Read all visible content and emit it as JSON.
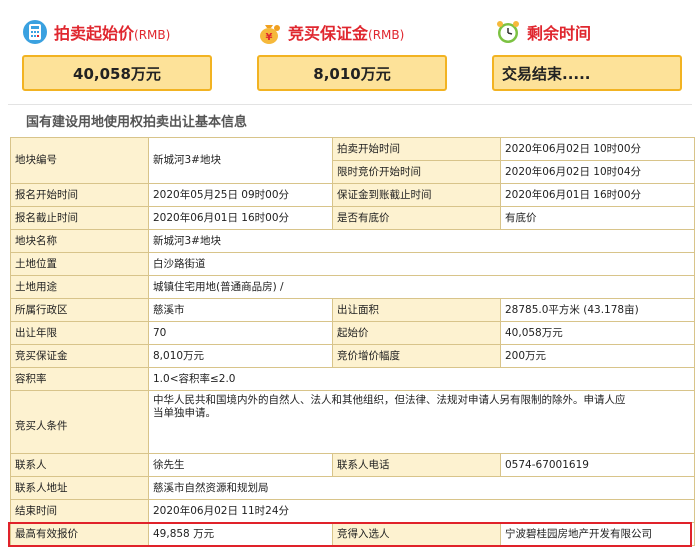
{
  "header": {
    "start_price": {
      "label": "拍卖起始价",
      "unit": "(RMB)",
      "value": "40,058万元",
      "icon": "calculator-icon"
    },
    "deposit": {
      "label": "竞买保证金",
      "unit": "(RMB)",
      "value": "8,010万元",
      "icon": "money-bag-icon"
    },
    "remaining": {
      "label": "剩余时间",
      "value": "交易结束.....",
      "icon": "alarm-clock-icon"
    }
  },
  "section_title": "国有建设用地使用权拍卖出让基本信息",
  "table": {
    "parcel_no_label": "地块编号",
    "parcel_no": "新城河3#地块",
    "auction_start_label": "拍卖开始时间",
    "auction_start": "2020年06月02日  10时00分",
    "bid_start_label": "限时竞价开始时间",
    "bid_start": "2020年06月02日  10时04分",
    "reg_start_label": "报名开始时间",
    "reg_start": "2020年05月25日  09时00分",
    "deposit_deadline_label": "保证金到账截止时间",
    "deposit_deadline": "2020年06月01日  16时00分",
    "reg_end_label": "报名截止时间",
    "reg_end": "2020年06月01日  16时00分",
    "reserve_label": "是否有底价",
    "reserve": "有底价",
    "parcel_name_label": "地块名称",
    "parcel_name": "新城河3#地块",
    "location_label": "土地位置",
    "location": "白沙路街道",
    "use_label": "土地用途",
    "use": "城镇住宅用地(普通商品房) /",
    "district_label": "所属行政区",
    "district": "慈溪市",
    "area_label": "出让面积",
    "area": "28785.0平方米 (43.178亩)",
    "years_label": "出让年限",
    "years": "70",
    "start_price_label": "起始价",
    "start_price": "40,058万元",
    "deposit_label": "竞买保证金",
    "deposit": "8,010万元",
    "increment_label": "竞价增价幅度",
    "increment": "200万元",
    "far_label": "容积率",
    "far": "1.0<容积率≤2.0",
    "bidder_label": "竞买人条件",
    "bidder": "中华人民共和国境内外的自然人、法人和其他组织，但法律、法规对申请人另有限制的除外。申请人应当单独申请。",
    "contact_label": "联系人",
    "contact": "徐先生",
    "phone_label": "联系人电话",
    "phone": "0574-67001619",
    "address_label": "联系人地址",
    "address": "慈溪市自然资源和规划局",
    "end_time_label": "结束时间",
    "end_time": "2020年06月02日  11时24分",
    "top_bid_label": "最高有效报价",
    "top_bid": "49,858 万元",
    "winner_label": "竞得入选人",
    "winner": "宁波碧桂园房地产开发有限公司"
  }
}
